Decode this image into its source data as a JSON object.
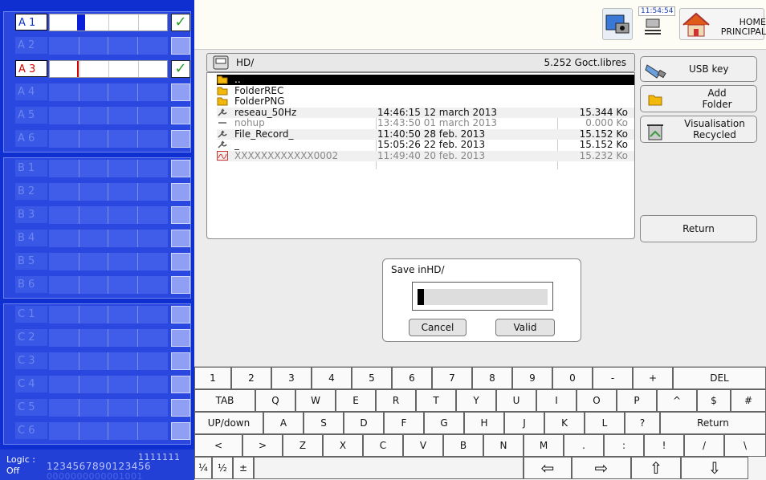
{
  "channels": {
    "group_a": [
      {
        "label": "A 1",
        "state": "on",
        "label_color": "#1030c8",
        "checked": true,
        "mark_color": "#0a20d8"
      },
      {
        "label": "A 2",
        "state": "off",
        "checked": false
      },
      {
        "label": "A 3",
        "state": "on",
        "label_color": "#d00000",
        "checked": true,
        "mark_color": "#d00000"
      },
      {
        "label": "A 4",
        "state": "off",
        "checked": false
      },
      {
        "label": "A 5",
        "state": "off",
        "checked": false
      },
      {
        "label": "A 6",
        "state": "off",
        "checked": false
      }
    ],
    "group_b": [
      {
        "label": "B 1",
        "state": "off",
        "checked": false
      },
      {
        "label": "B 2",
        "state": "off",
        "checked": false
      },
      {
        "label": "B 3",
        "state": "off",
        "checked": false
      },
      {
        "label": "B 4",
        "state": "off",
        "checked": false
      },
      {
        "label": "B 5",
        "state": "off",
        "checked": false
      },
      {
        "label": "B 6",
        "state": "off",
        "checked": false
      }
    ],
    "group_c": [
      {
        "label": "C 1",
        "state": "off",
        "checked": false
      },
      {
        "label": "C 2",
        "state": "off",
        "checked": false
      },
      {
        "label": "C 3",
        "state": "off",
        "checked": false
      },
      {
        "label": "C 4",
        "state": "off",
        "checked": false
      },
      {
        "label": "C 5",
        "state": "off",
        "checked": false
      },
      {
        "label": "C 6",
        "state": "off",
        "checked": false
      }
    ],
    "check_glyph": "✓"
  },
  "logic": {
    "label": "Logic :",
    "state": "Off",
    "digits_top": "1111111",
    "digits": "1234567890123456",
    "bits": "0000000000001001"
  },
  "topbar": {
    "time": "11:54:54",
    "home_label_1": "HOME",
    "home_label_2": "PRINCIPAL"
  },
  "file_browser": {
    "path": "HD/",
    "free_space": "5.252 Goct.libres",
    "rows": [
      {
        "icon": "folder-icon",
        "name": "..",
        "date": "",
        "size": "",
        "selected": true
      },
      {
        "icon": "folder-icon",
        "name": "FolderREC",
        "date": "",
        "size": ""
      },
      {
        "icon": "folder-icon",
        "name": "FolderPNG",
        "date": "",
        "size": ""
      },
      {
        "icon": "wrench-icon",
        "name": "reseau_50Hz",
        "date": "14:46:15 12 march 2013",
        "size": "15.344 Ko"
      },
      {
        "icon": "dash-icon",
        "name": "nohup",
        "date": "13:43:50 01 march 2013",
        "size": "0.000 Ko",
        "grey": true
      },
      {
        "icon": "wrench-icon",
        "name": "File_Record_",
        "date": "11:40:50 28 feb. 2013",
        "size": "15.152 Ko"
      },
      {
        "icon": "wrench-icon",
        "name": "_",
        "date": "15:05:26 22 feb. 2013",
        "size": "15.152 Ko"
      },
      {
        "icon": "chart-icon",
        "name": "XXXXXXXXXXXX0002",
        "date": "11:49:40 20 feb. 2013",
        "size": "15.232 Ko",
        "grey": true
      }
    ]
  },
  "side_buttons": {
    "usb": "USB key",
    "add_folder_1": "Add",
    "add_folder_2": "Folder",
    "recycled_1": "Visualisation",
    "recycled_2": "Recycled",
    "return": "Return"
  },
  "save_dialog": {
    "title": "Save inHD/",
    "input_value": "",
    "cancel": "Cancel",
    "valid": "Valid"
  },
  "keyboard": {
    "row1": [
      "1",
      "2",
      "3",
      "4",
      "5",
      "6",
      "7",
      "8",
      "9",
      "0",
      "-",
      "+",
      "DEL"
    ],
    "row2": [
      "TAB",
      "Q",
      "W",
      "E",
      "R",
      "T",
      "Y",
      "U",
      "I",
      "O",
      "P",
      "^",
      "$",
      "#"
    ],
    "row3": [
      "UP/down",
      "A",
      "S",
      "D",
      "F",
      "G",
      "H",
      "J",
      "K",
      "L",
      "?",
      "Return"
    ],
    "row4": [
      "<",
      ">",
      "Z",
      "X",
      "C",
      "V",
      "B",
      "N",
      "M",
      ".",
      ":",
      "!",
      "/",
      "\\"
    ],
    "row5": [
      "¼",
      "½",
      "±",
      "",
      "⇦",
      "⇨",
      "⇧",
      "⇩"
    ]
  }
}
